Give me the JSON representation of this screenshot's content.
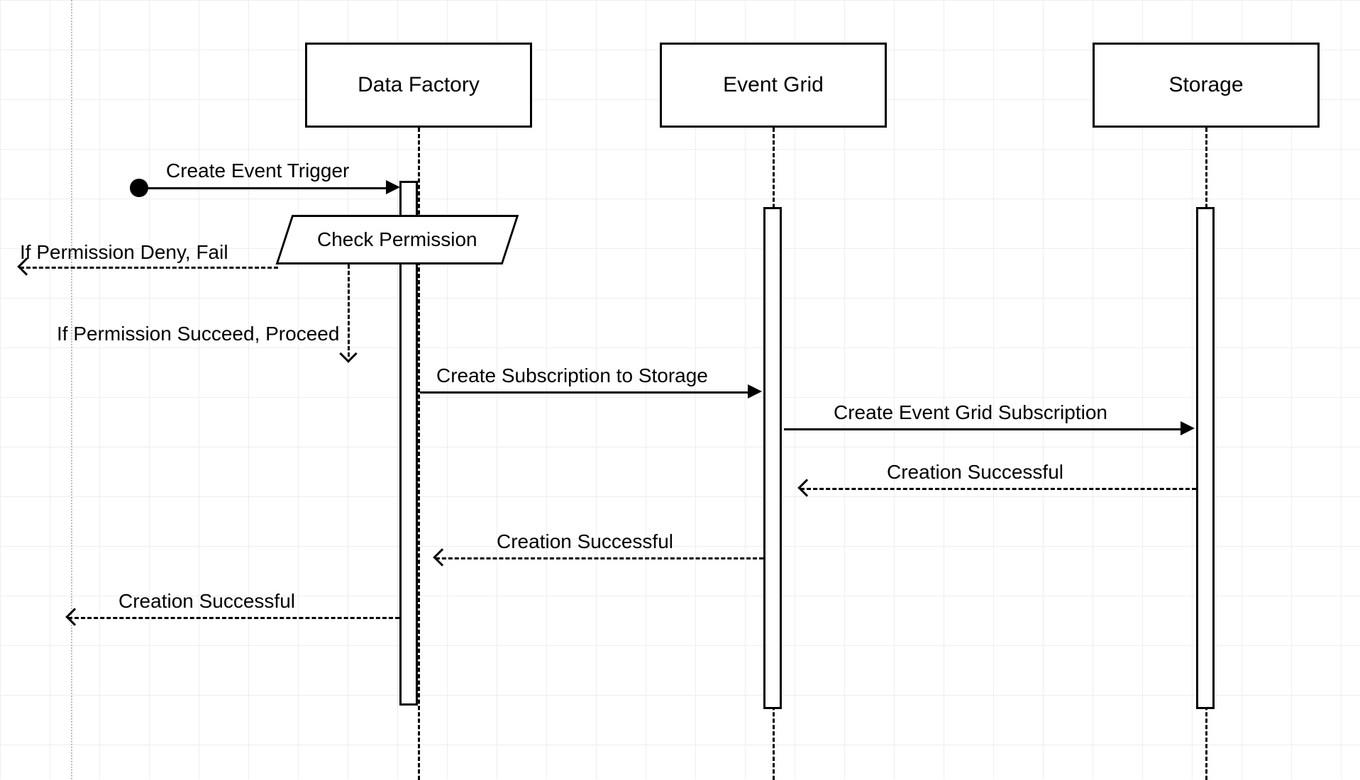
{
  "participants": {
    "data_factory": "Data Factory",
    "event_grid": "Event Grid",
    "storage": "Storage"
  },
  "messages": {
    "create_event_trigger": "Create Event Trigger",
    "check_permission": "Check Permission",
    "permission_deny": "If Permission Deny, Fail",
    "permission_succeed": "If Permission Succeed, Proceed",
    "create_subscription_storage": "Create Subscription to Storage",
    "create_event_grid_subscription": "Create Event Grid Subscription",
    "creation_successful_1": "Creation Successful",
    "creation_successful_2": "Creation Successful",
    "creation_successful_3": "Creation Successful"
  }
}
